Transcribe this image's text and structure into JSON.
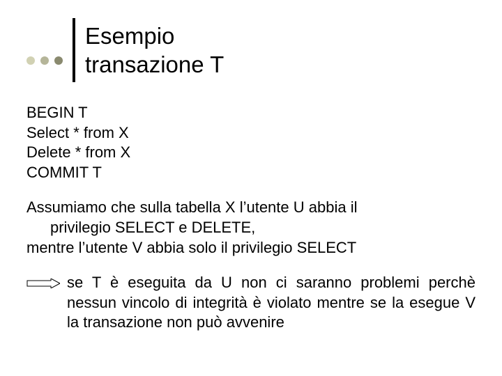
{
  "title": {
    "line1": "Esempio",
    "line2": "transazione T"
  },
  "code": {
    "l1": "BEGIN T",
    "l2": "Select * from X",
    "l3": "Delete * from X",
    "l4": "COMMIT T"
  },
  "assume": {
    "part1": "Assumiamo che sulla tabella X l’utente U abbia il",
    "part2": "privilegio SELECT e DELETE,",
    "line2": "mentre l’utente V abbia solo il privilegio SELECT"
  },
  "result": {
    "line1": "se T è eseguita da U non ci saranno problemi",
    "rest": "perchè nessun vincolo di integrità è violato mentre se la esegue V la transazione non può avvenire"
  }
}
